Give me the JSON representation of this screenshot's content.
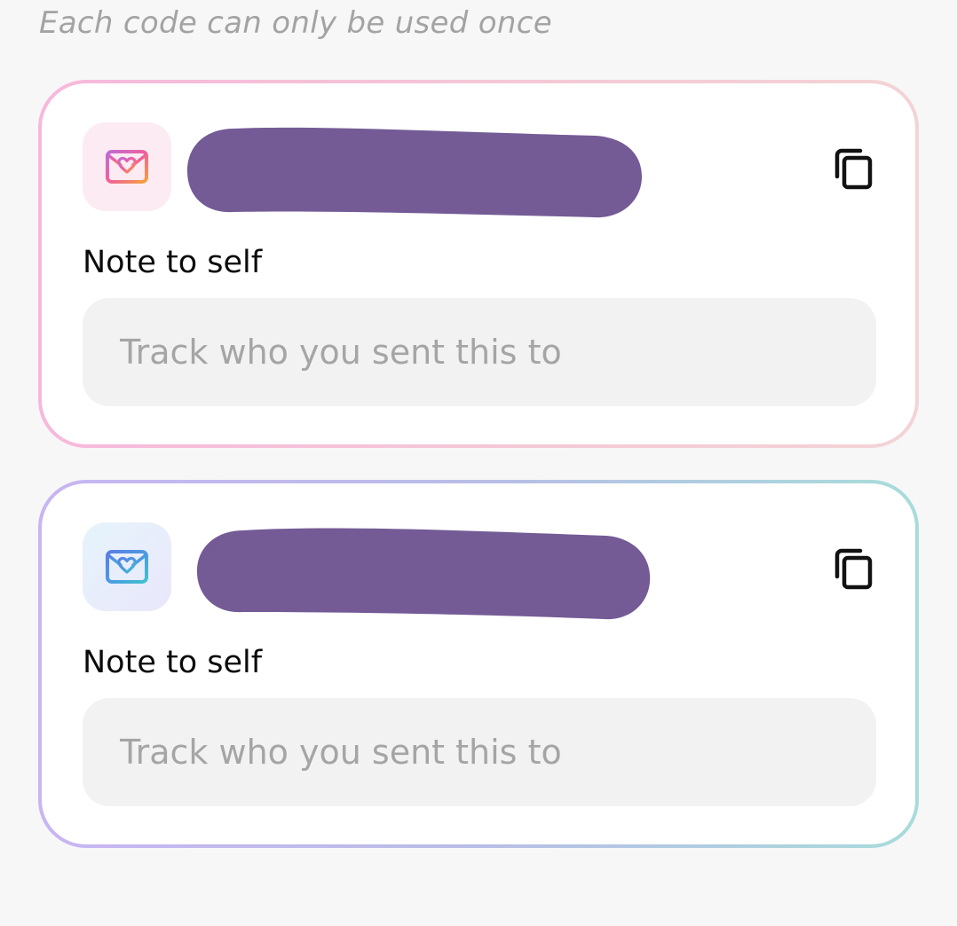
{
  "hint": "Each code can only be used once",
  "cards": [
    {
      "icon": "envelope-heart-icon",
      "code_label": "Note to self",
      "note_placeholder": "Track who you sent this to",
      "note_value": "",
      "copy_icon": "copy-icon"
    },
    {
      "icon": "envelope-heart-icon",
      "code_label": "Note to self",
      "note_placeholder": "Track who you sent this to",
      "note_value": "",
      "copy_icon": "copy-icon"
    }
  ],
  "colors": {
    "background": "#f7f7f7",
    "card_background": "#ffffff",
    "card1_border_gradient": [
      "#f7b8dc",
      "#f3d4d6"
    ],
    "card2_border_gradient": [
      "#c8b5f3",
      "#a8dcda"
    ],
    "redaction": "#745b96",
    "input_background": "#f2f2f2",
    "placeholder_text": "#a5a5a5",
    "hint_text": "#a3a3a3"
  }
}
